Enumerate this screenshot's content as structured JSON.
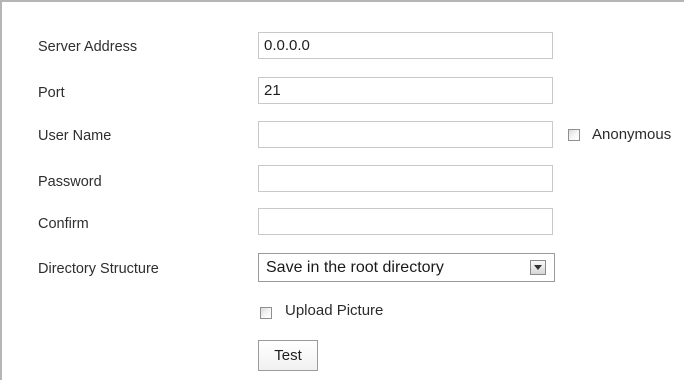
{
  "form": {
    "server_address": {
      "label": "Server Address",
      "value": "0.0.0.0"
    },
    "port": {
      "label": "Port",
      "value": "21"
    },
    "user_name": {
      "label": "User Name",
      "value": "",
      "anonymous_label": "Anonymous",
      "anonymous_checked": false
    },
    "password": {
      "label": "Password",
      "value": ""
    },
    "confirm": {
      "label": "Confirm",
      "value": ""
    },
    "directory_structure": {
      "label": "Directory Structure",
      "selected": "Save in the root directory"
    },
    "upload_picture": {
      "label": "Upload Picture",
      "checked": false
    },
    "test_button_label": "Test"
  }
}
